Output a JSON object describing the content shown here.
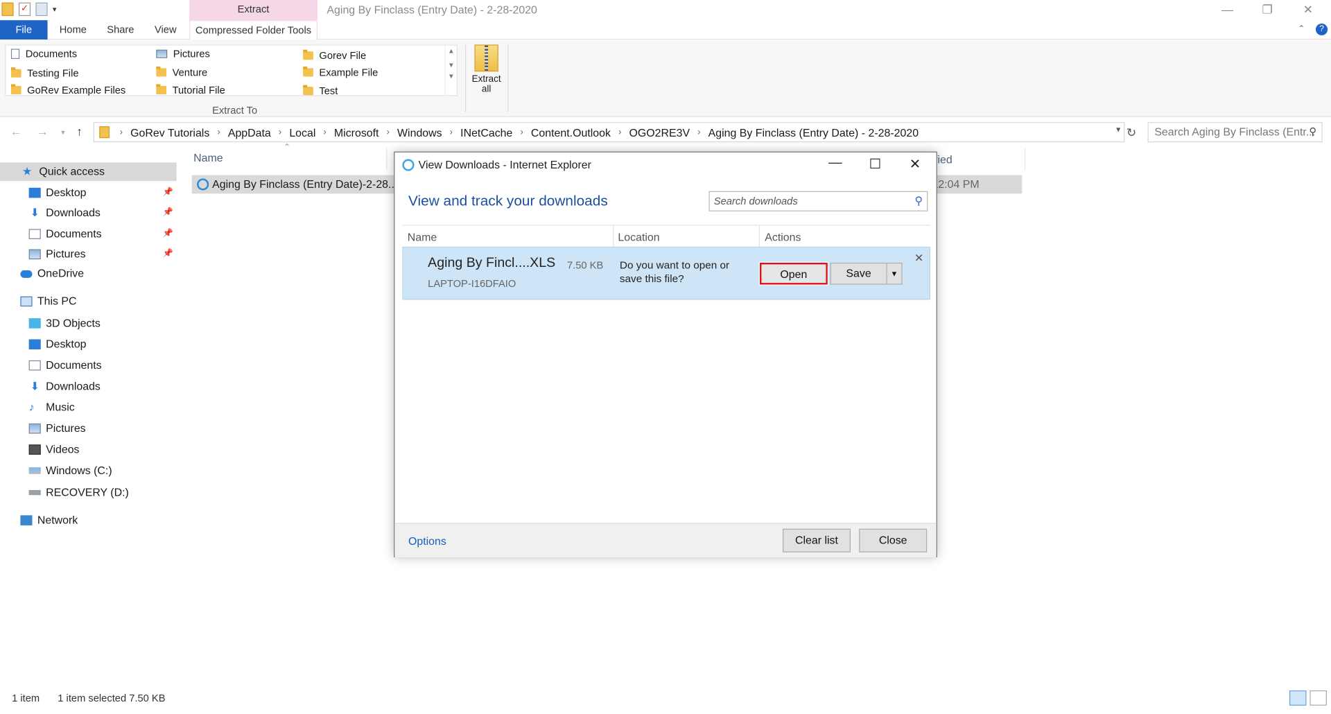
{
  "window": {
    "title": "Aging By Finclass (Entry Date) - 2-28-2020",
    "context_tab_header": "Extract"
  },
  "ribbon": {
    "tabs": {
      "file": "File",
      "home": "Home",
      "share": "Share",
      "view": "View",
      "ctx": "Compressed Folder Tools"
    },
    "gallery": {
      "col1": [
        "Documents",
        "Testing File",
        "GoRev Example Files"
      ],
      "col2": [
        "Pictures",
        "Venture",
        "Tutorial File"
      ],
      "col3": [
        "Gorev File",
        "Example File",
        "Test"
      ]
    },
    "group_label": "Extract To",
    "extract_all_l1": "Extract",
    "extract_all_l2": "all",
    "help": "?"
  },
  "address": {
    "crumbs": [
      "GoRev Tutorials",
      "AppData",
      "Local",
      "Microsoft",
      "Windows",
      "INetCache",
      "Content.Outlook",
      "OGO2RE3V",
      "Aging By Finclass (Entry Date) - 2-28-2020"
    ],
    "search_placeholder": "Search Aging By Finclass (Entr..."
  },
  "navpane": {
    "quick_access": "Quick access",
    "qa_items": [
      "Desktop",
      "Downloads",
      "Documents",
      "Pictures"
    ],
    "onedrive": "OneDrive",
    "this_pc": "This PC",
    "pc_items": [
      "3D Objects",
      "Desktop",
      "Documents",
      "Downloads",
      "Music",
      "Pictures",
      "Videos",
      "Windows (C:)",
      "RECOVERY (D:)"
    ],
    "network": "Network"
  },
  "filelist": {
    "col_name": "Name",
    "col_modified_partial": "ified",
    "file_name": "Aging By Finclass (Entry Date)-2-28...",
    "file_date_partial": "12:04 PM"
  },
  "status": {
    "count": "1 item",
    "selected": "1 item selected  7.50 KB"
  },
  "dialog": {
    "title": "View Downloads - Internet Explorer",
    "heading": "View and track your downloads",
    "search_placeholder": "Search downloads",
    "columns": {
      "name": "Name",
      "location": "Location",
      "actions": "Actions"
    },
    "item": {
      "name": "Aging By Fincl....XLS",
      "size": "7.50 KB",
      "host": "LAPTOP-I16DFAIO",
      "question": "Do you want to open or save this file?",
      "open": "Open",
      "save": "Save"
    },
    "options": "Options",
    "clear_list": "Clear list",
    "close": "Close"
  }
}
